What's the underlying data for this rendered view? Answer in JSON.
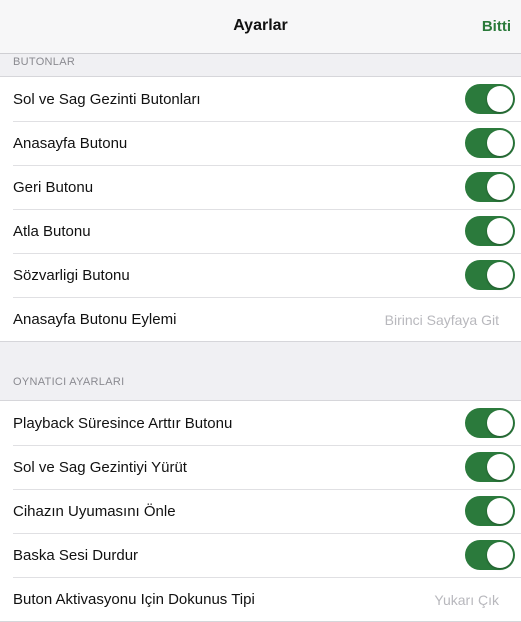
{
  "navbar": {
    "title": "Ayarlar",
    "done_label": "Bitti"
  },
  "colors": {
    "accent": "#2b7a3c",
    "background": "#f0f0f3",
    "value_text": "#b8b8bd"
  },
  "sections": [
    {
      "header": "BUTONLAR",
      "rows": [
        {
          "label": "Sol ve Sag Gezinti Butonları",
          "type": "toggle",
          "on": true
        },
        {
          "label": "Anasayfa Butonu",
          "type": "toggle",
          "on": true
        },
        {
          "label": "Geri Butonu",
          "type": "toggle",
          "on": true
        },
        {
          "label": "Atla Butonu",
          "type": "toggle",
          "on": true
        },
        {
          "label": "Sözvarligi Butonu",
          "type": "toggle",
          "on": true
        },
        {
          "label": "Anasayfa Butonu Eylemi",
          "type": "value",
          "value": "Birinci Sayfaya Git"
        }
      ]
    },
    {
      "header": "OYNATICI AYARLARI",
      "rows": [
        {
          "label": "Playback Süresince Arttır Butonu",
          "type": "toggle",
          "on": true
        },
        {
          "label": "Sol ve Sag Gezintiyi Yürüt",
          "type": "toggle",
          "on": true
        },
        {
          "label": "Cihazın Uyumasını Önle",
          "type": "toggle",
          "on": true
        },
        {
          "label": "Baska Sesi Durdur",
          "type": "toggle",
          "on": true
        },
        {
          "label": "Buton Aktivasyonu Için Dokunus Tipi",
          "type": "value",
          "value": "Yukarı Çık"
        }
      ]
    }
  ]
}
